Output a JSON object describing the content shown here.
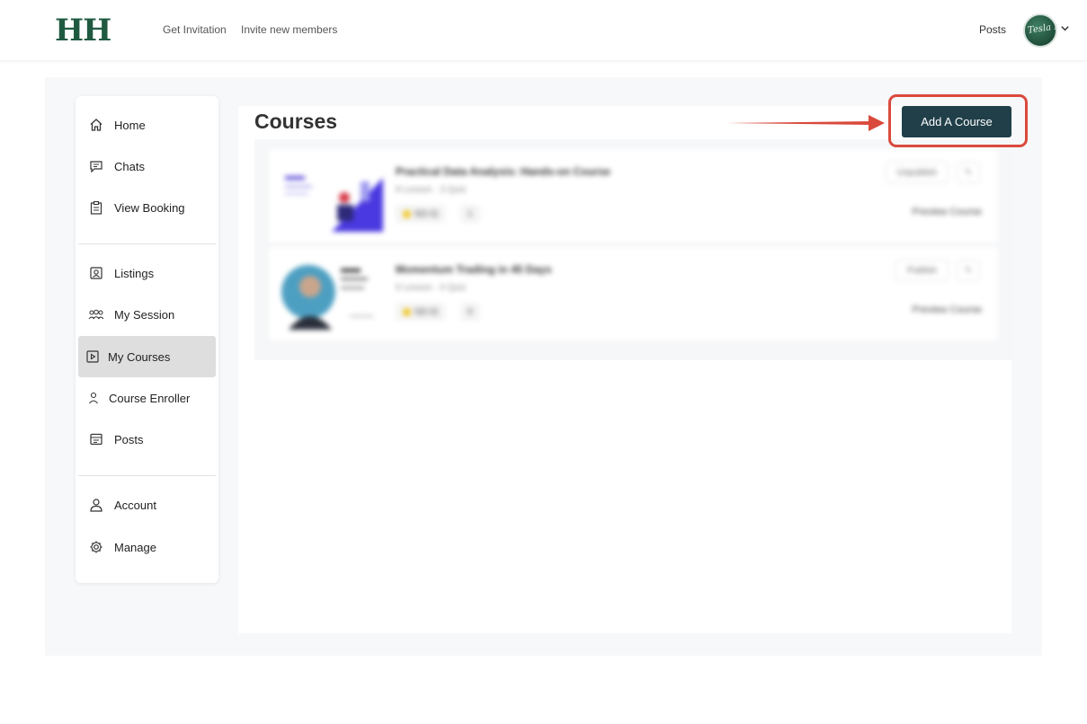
{
  "header": {
    "logo": "HH",
    "nav": {
      "get_invitation": "Get Invitation",
      "invite_members": "Invite new members"
    },
    "posts": "Posts",
    "avatar_signature": "Tesla Hi"
  },
  "sidebar": {
    "items": [
      {
        "label": "Home",
        "icon": "home-icon"
      },
      {
        "label": "Chats",
        "icon": "chat-icon"
      },
      {
        "label": "View Booking",
        "icon": "clipboard-icon"
      },
      {
        "label": "Listings",
        "icon": "listing-icon"
      },
      {
        "label": "My Session",
        "icon": "group-icon"
      },
      {
        "label": "My Courses",
        "icon": "play-square-icon",
        "active": true
      },
      {
        "label": "Course Enroller",
        "icon": "user-icon"
      },
      {
        "label": "Posts",
        "icon": "posts-icon"
      },
      {
        "label": "Account",
        "icon": "account-icon"
      },
      {
        "label": "Manage",
        "icon": "gear-icon"
      }
    ]
  },
  "main": {
    "title": "Courses",
    "add_button": "Add A Course",
    "courses": [
      {
        "title": "Practical Data Analysis: Hands-on Course",
        "meta": "8 Lesson · 3 Quiz",
        "rating": "5(0.0)",
        "enrolled": "1",
        "status": "Unpublish",
        "preview": "Preview Course"
      },
      {
        "title": "Momentum Trading in 45 Days",
        "meta": "5 Lesson · 0 Quiz",
        "rating": "0(0.0)",
        "enrolled": "0",
        "status": "Publish",
        "preview": "Preview Course"
      }
    ]
  },
  "colors": {
    "brand": "#1f5a40",
    "button": "#203f49",
    "annotation": "#d94a3c",
    "active_item": "#dedede"
  }
}
